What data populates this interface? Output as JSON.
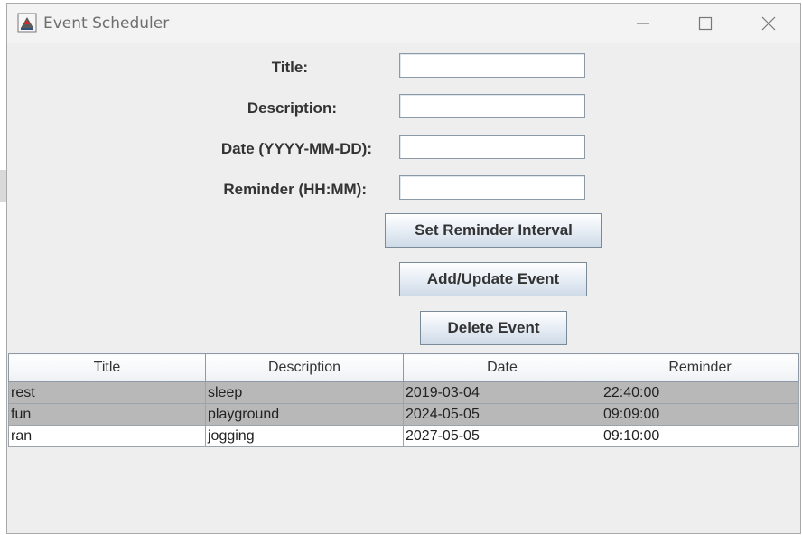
{
  "window": {
    "title": "Event Scheduler"
  },
  "form": {
    "title_label": "Title:",
    "description_label": "Description:",
    "date_label": "Date (YYYY-MM-DD):",
    "reminder_label": "Reminder (HH:MM):",
    "title_value": "",
    "description_value": "",
    "date_value": "",
    "reminder_value": ""
  },
  "buttons": {
    "set_reminder_interval": "Set Reminder Interval",
    "add_update_event": "Add/Update Event",
    "delete_event": "Delete Event"
  },
  "table": {
    "columns": [
      "Title",
      "Description",
      "Date",
      "Reminder"
    ],
    "rows": [
      {
        "title": "rest",
        "description": "sleep",
        "date": "2019-03-04",
        "reminder": "22:40:00",
        "selected": true
      },
      {
        "title": "fun",
        "description": "playground",
        "date": "2024-05-05",
        "reminder": "09:09:00",
        "selected": true
      },
      {
        "title": "ran",
        "description": "jogging",
        "date": "2027-05-05",
        "reminder": "09:10:00",
        "selected": false
      }
    ]
  },
  "colors": {
    "selected_row": "#b8b8b8",
    "window_bg": "#eeeeee"
  },
  "icons": {
    "app": "java-cup-icon",
    "minimize": "minimize-icon",
    "maximize": "maximize-icon",
    "close": "close-icon"
  }
}
